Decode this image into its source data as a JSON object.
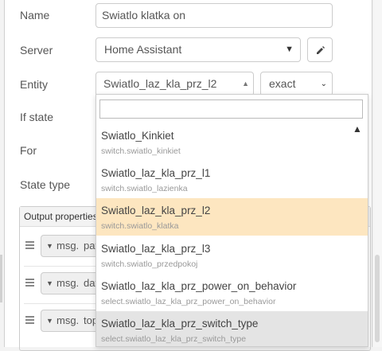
{
  "form": {
    "name_label": "Name",
    "name_value": "Swiatlo klatka on",
    "server_label": "Server",
    "server_value": "Home Assistant",
    "entity_label": "Entity",
    "entity_value": "Swiatlo_laz_kla_prz_l2",
    "match_value": "exact",
    "if_state_label": "If state",
    "for_label": "For",
    "state_type_label": "State type"
  },
  "output": {
    "header": "Output properties",
    "rows": [
      {
        "type": "msg.",
        "value": "pay"
      },
      {
        "type": "msg.",
        "value": "dat"
      },
      {
        "type": "msg.",
        "value": "top"
      }
    ]
  },
  "dropdown": {
    "search_value": "",
    "items": [
      {
        "name": "Swiatlo_Kinkiet",
        "id": "switch.swiatlo_kinkiet",
        "state": "normal"
      },
      {
        "name": "Swiatlo_laz_kla_prz_l1",
        "id": "switch.swiatlo_lazienka",
        "state": "normal"
      },
      {
        "name": "Swiatlo_laz_kla_prz_l2",
        "id": "switch.swiatlo_klatka",
        "state": "selected"
      },
      {
        "name": "Swiatlo_laz_kla_prz_l3",
        "id": "switch.swiatlo_przedpokoj",
        "state": "normal"
      },
      {
        "name": "Swiatlo_laz_kla_prz_power_on_behavior",
        "id": "select.swiatlo_laz_kla_prz_power_on_behavior",
        "state": "normal"
      },
      {
        "name": "Swiatlo_laz_kla_prz_switch_type",
        "id": "select.swiatlo_laz_kla_prz_switch_type",
        "state": "hover"
      }
    ]
  },
  "colors": {
    "selected": "#fde6c0",
    "hover": "#e4e4e4"
  }
}
